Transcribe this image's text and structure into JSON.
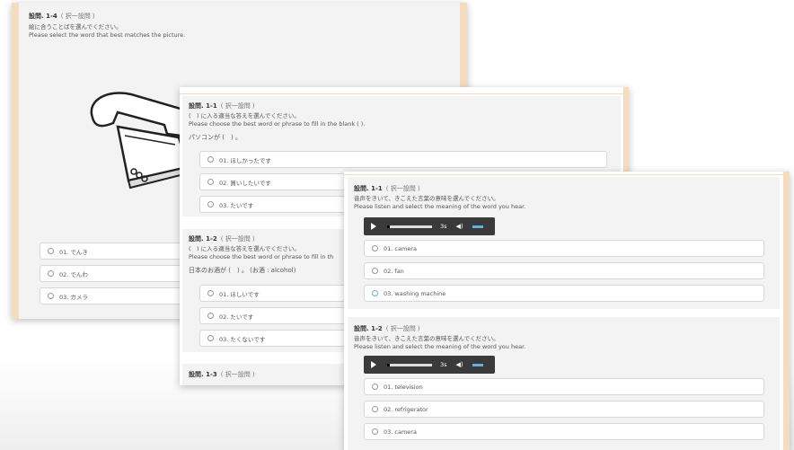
{
  "panel1": {
    "title": "設問. 1-4",
    "subtitle": "( 択一設問 )",
    "instruction_jp": "絵に合うことばを選んでください。",
    "instruction_en": "Please select the word that best matches the picture.",
    "options": [
      "01.  でんき",
      "02.  でんわ",
      "03.  カメラ"
    ]
  },
  "panel2": {
    "q1": {
      "title": "設問. 1-1",
      "subtitle": "( 択一設問 )",
      "instruction_jp": "(　) に入る適当な答えを選んでください。",
      "instruction_en": "Please choose the best word or phrase to fill in the blank (  ).",
      "sentence": "パソコンが (　) 。",
      "options": [
        "01.  ほしかったです",
        "02.  買いしたいです",
        "03.  たいです"
      ]
    },
    "q2": {
      "title": "設問. 1-2",
      "subtitle": "( 択一設問 )",
      "instruction_jp": "(　) に入る適当な答えを選んでください。",
      "instruction_en": "Please choose the best word or phrase to fill in th",
      "sentence": "日本のお酒が (　) 。 (お酒 : alcohol)",
      "options": [
        "01.  ほしいです",
        "02.  たいです",
        "03.  たくないです"
      ]
    },
    "q3": {
      "title": "設問. 1-3",
      "subtitle": "( 択一設問 )"
    }
  },
  "panel3": {
    "q1": {
      "title": "設問. 1-1",
      "subtitle": "( 択一設問 )",
      "instruction_jp": "音声をきいて、きこえた言葉の意味を選んでください。",
      "instruction_en": "Please listen and select the meaning of the word you hear.",
      "time": "3s",
      "options": [
        "01.  camera",
        "02.  fan",
        "03.  washing machine"
      ]
    },
    "q2": {
      "title": "設問. 1-2",
      "subtitle": "( 択一設問 )",
      "instruction_jp": "音声をきいて、きこえた言葉の意味を選んでください。",
      "instruction_en": "Please listen and select the meaning of the word you hear.",
      "time": "3s",
      "options": [
        "01.  television",
        "02.  refrigerator",
        "03.  camera"
      ]
    }
  },
  "icons": {
    "play": "play-icon",
    "volume": "volume-icon",
    "picture": "telephone-illustration"
  },
  "colors": {
    "panel_border": "#f5dcc0",
    "accent": "#6aaedc",
    "player_bg": "#3a3a3a"
  }
}
